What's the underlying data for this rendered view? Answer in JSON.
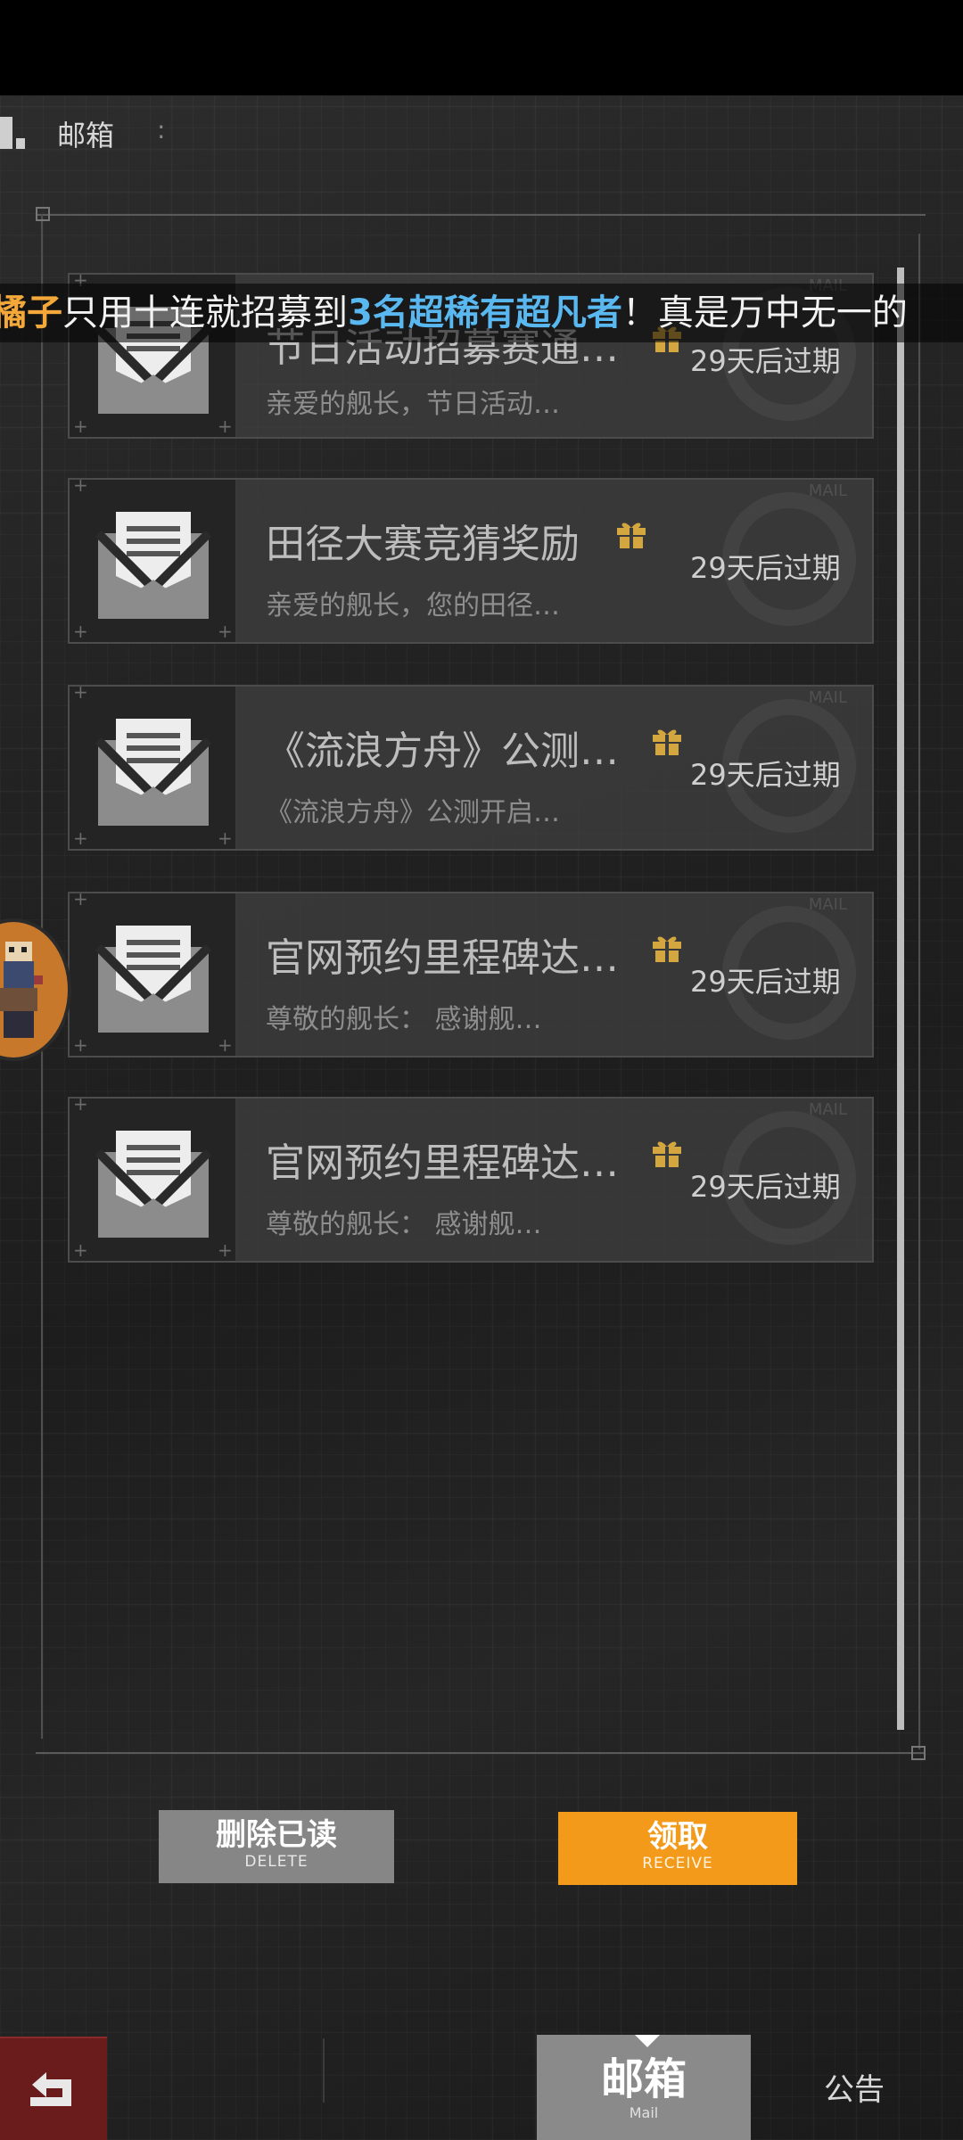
{
  "header": {
    "title": "邮箱",
    "colon": ":"
  },
  "banner": {
    "prefix_highlight": "橘子",
    "text_1": "只用十连就招募到",
    "highlight_2": "3名超稀有超凡者",
    "text_2": "！真是万中无一的"
  },
  "mails": [
    {
      "title": "节日活动招募赛通…",
      "preview": "亲爱的舰长，节日活动…",
      "expiry": "29天后过期",
      "has_gift": true,
      "watermark": "MAIL"
    },
    {
      "title": "田径大赛竞猜奖励",
      "preview": "亲爱的舰长，您的田径…",
      "expiry": "29天后过期",
      "has_gift": true,
      "watermark": "MAIL"
    },
    {
      "title": "《流浪方舟》公测…",
      "preview": "《流浪方舟》公测开启…",
      "expiry": "29天后过期",
      "has_gift": true,
      "watermark": "MAIL"
    },
    {
      "title": "官网预约里程碑达…",
      "preview": "尊敬的舰长：  感谢舰…",
      "expiry": "29天后过期",
      "has_gift": true,
      "watermark": "MAIL"
    },
    {
      "title": "官网预约里程碑达…",
      "preview": "尊敬的舰长：  感谢舰…",
      "expiry": "29天后过期",
      "has_gift": true,
      "watermark": "MAIL"
    }
  ],
  "actions": {
    "delete_label": "删除已读",
    "delete_sub": "DELETE",
    "receive_label": "领取",
    "receive_sub": "RECEIVE"
  },
  "bottom_nav": {
    "mail_label": "邮箱",
    "mail_sub": "Mail",
    "notice_label": "公告"
  },
  "colors": {
    "accent": "#f39a1b",
    "gift": "#d4a640",
    "back": "#6a1b1b"
  }
}
